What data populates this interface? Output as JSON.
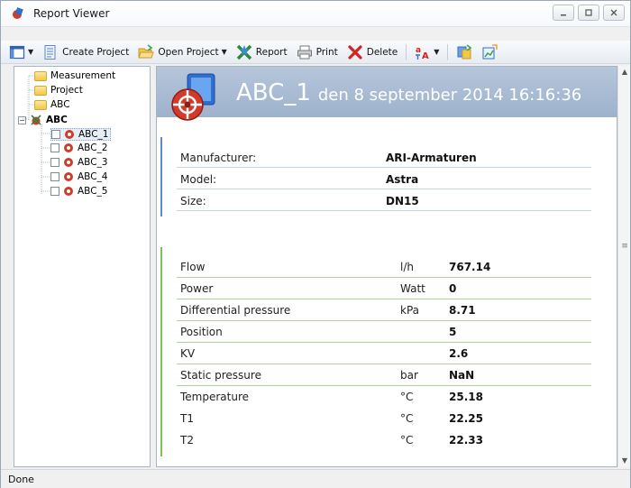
{
  "window": {
    "title": "Report Viewer"
  },
  "toolbar": {
    "create_project": "Create Project",
    "open_project": "Open Project",
    "report": "Report",
    "print": "Print",
    "delete": "Delete"
  },
  "tree": {
    "items": [
      {
        "label": "Measurement"
      },
      {
        "label": "Project"
      },
      {
        "label": "ABC"
      },
      {
        "label": "ABC"
      },
      {
        "label": "ABC_1"
      },
      {
        "label": "ABC_2"
      },
      {
        "label": "ABC_3"
      },
      {
        "label": "ABC_4"
      },
      {
        "label": "ABC_5"
      }
    ],
    "selected": "ABC_1"
  },
  "report": {
    "name": "ABC_1",
    "date": "den 8 september 2014 16:16:36",
    "device": [
      {
        "label": "Manufacturer:",
        "value": "ARI-Armaturen"
      },
      {
        "label": "Model:",
        "value": "Astra"
      },
      {
        "label": "Size:",
        "value": "DN15"
      }
    ],
    "measurements": [
      {
        "label": "Flow",
        "unit": "l/h",
        "value": "767.14"
      },
      {
        "label": "Power",
        "unit": "Watt",
        "value": "0"
      },
      {
        "label": "Differential pressure",
        "unit": "kPa",
        "value": "8.71"
      },
      {
        "label": "Position",
        "unit": "",
        "value": "5"
      },
      {
        "label": "KV",
        "unit": "",
        "value": "2.6"
      },
      {
        "label": "Static pressure",
        "unit": "bar",
        "value": "NaN"
      },
      {
        "label": "Temperature",
        "unit": "°C",
        "value": "25.18"
      },
      {
        "label": "T1",
        "unit": "°C",
        "value": "22.25"
      },
      {
        "label": "T2",
        "unit": "°C",
        "value": "22.33"
      }
    ]
  },
  "status": {
    "text": "Done"
  },
  "colors": {
    "banner": "#a9bcd3",
    "device_line": "#c7d3e6",
    "measure_line": "#a9d89c",
    "accent_blue": "#5b8cc9",
    "accent_green": "#7cc15a"
  }
}
